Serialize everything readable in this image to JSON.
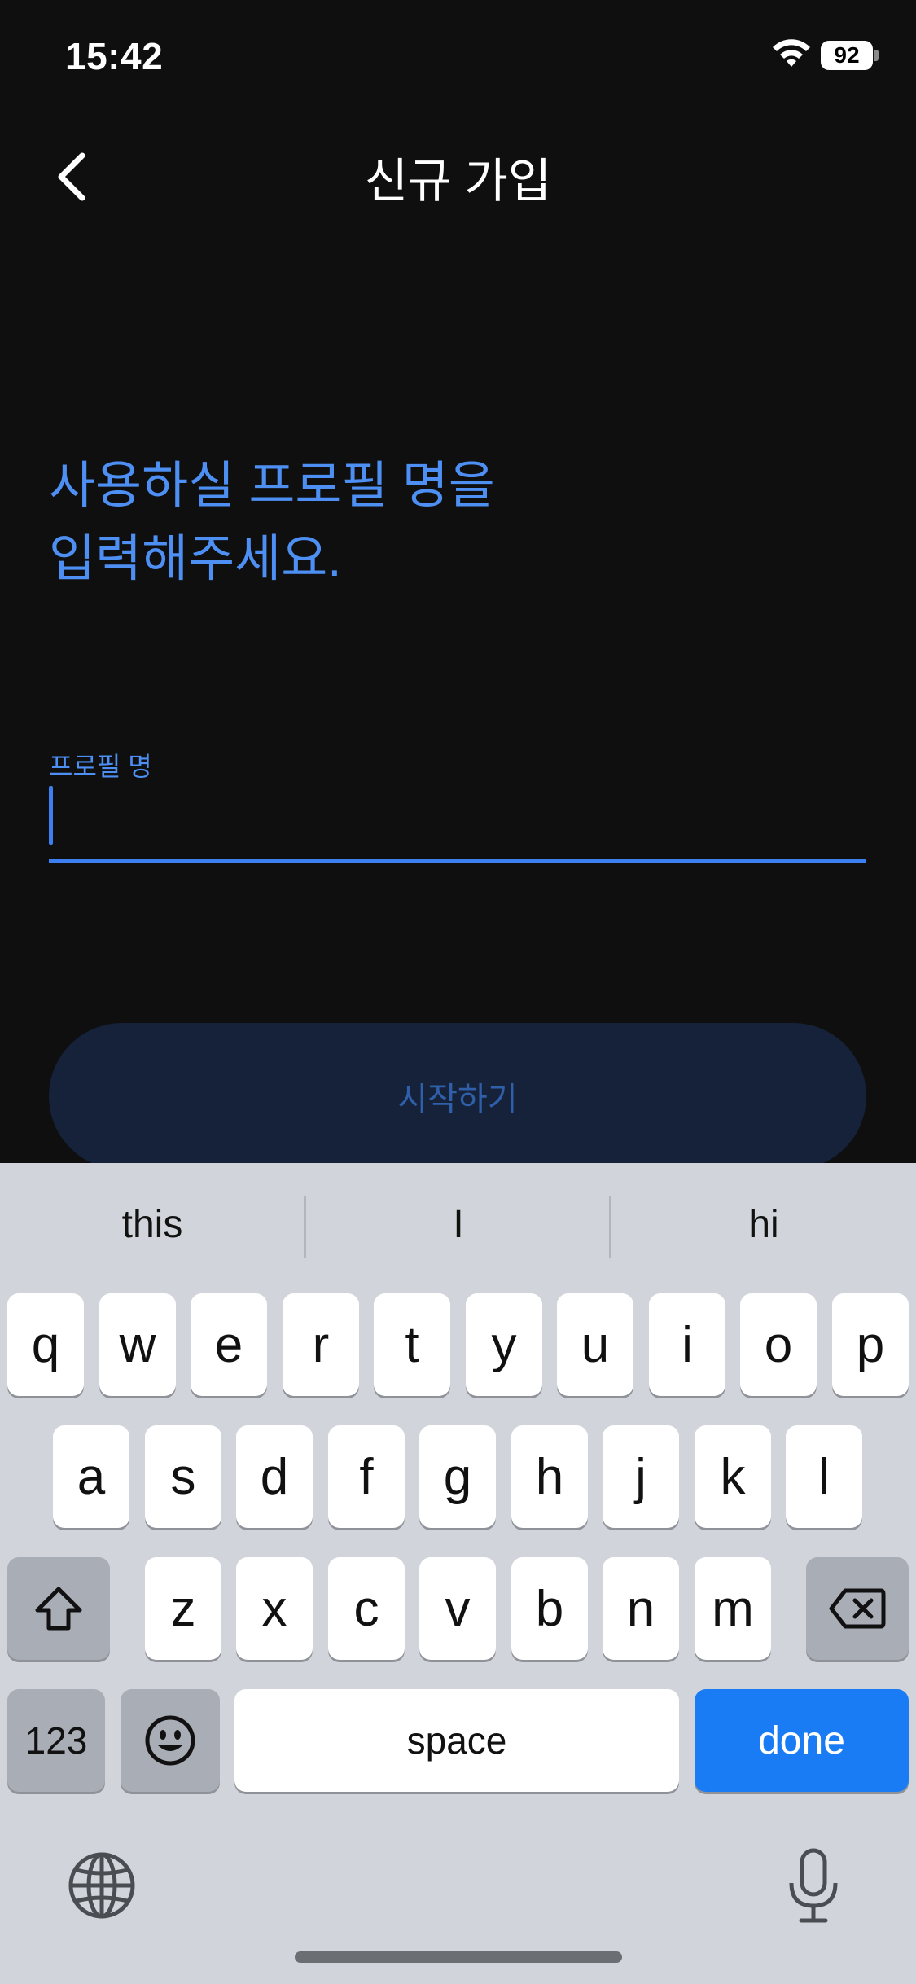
{
  "status_bar": {
    "time": "15:42",
    "battery": "92"
  },
  "nav": {
    "title": "신규 가입"
  },
  "heading": {
    "line1": "사용하실 프로필 명을",
    "line2": "입력해주세요."
  },
  "field": {
    "label": "프로필 명",
    "value": ""
  },
  "start_button": {
    "label": "시작하기"
  },
  "keyboard": {
    "suggestions": [
      "this",
      "I",
      "hi"
    ],
    "row1": [
      "q",
      "w",
      "e",
      "r",
      "t",
      "y",
      "u",
      "i",
      "o",
      "p"
    ],
    "row2": [
      "a",
      "s",
      "d",
      "f",
      "g",
      "h",
      "j",
      "k",
      "l"
    ],
    "row3": [
      "z",
      "x",
      "c",
      "v",
      "b",
      "n",
      "m"
    ],
    "numbers_label": "123",
    "space_label": "space",
    "done_label": "done"
  },
  "colors": {
    "accent": "#4d8ff2",
    "done_key": "#1a7cf5",
    "background": "#0f0f10"
  }
}
